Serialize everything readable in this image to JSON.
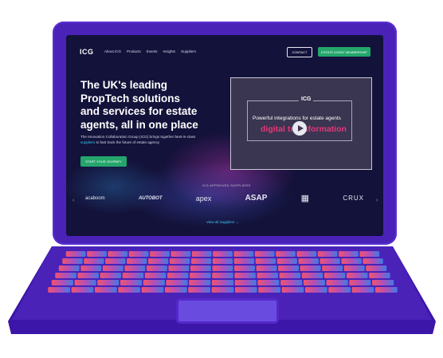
{
  "site": {
    "logo": "ICG",
    "nav": [
      "About ICG",
      "Products",
      "Events",
      "Insights",
      "Suppliers"
    ],
    "contact_label": "CONTACT",
    "member_label": "ESTATE AGENT MEMBERSHIP"
  },
  "hero": {
    "title": "The UK's leading PropTech solutions and services for estate agents, all in one place",
    "desc_part1": "The Innovation Collaboration Group (ICG) brings together best-in-class ",
    "desc_link": "suppliers",
    "desc_part2": " to fast track the future of estate agency",
    "cta_label": "START YOUR JOURNEY"
  },
  "video": {
    "logo": "ICG",
    "line1": "Powerful integrations for estate agents",
    "line2": "digital transformation"
  },
  "suppliers": {
    "heading": "ICG APPROVED SUPPLIERS",
    "logos": [
      "acaboom",
      "AUTOBOT",
      "apex",
      "ASAP",
      "▦",
      "CRUX"
    ],
    "view_all": "View all Suppliers →"
  },
  "colors": {
    "laptop": "#4a22b8",
    "screen_bg": "#13123a",
    "button_green": "#24a66c",
    "accent_pink": "#e4377a",
    "link_cyan": "#39c8ee"
  },
  "icons": {
    "play": "play-icon",
    "prev": "chevron-left-icon",
    "next": "chevron-right-icon"
  }
}
